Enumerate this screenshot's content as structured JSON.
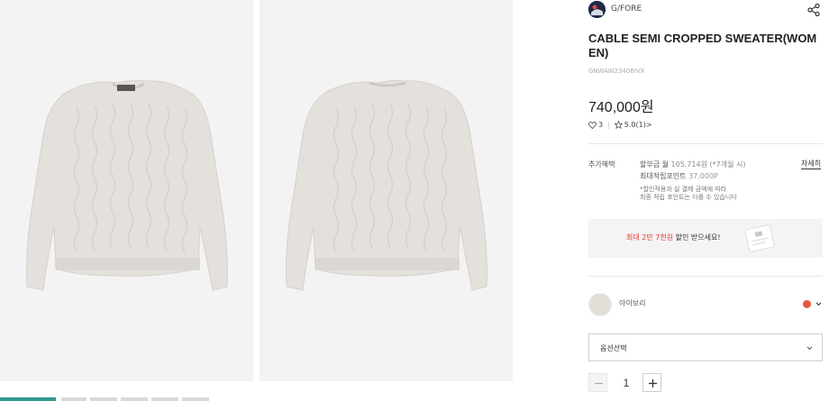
{
  "gallery": {
    "images": [
      {
        "icon": "sweater-front-image"
      },
      {
        "icon": "sweater-back-image"
      }
    ],
    "thumbnail_count": 6,
    "active_thumbnail": 1
  },
  "product": {
    "brand": "G/FORE",
    "brand_logo_icon": "brand-logo-icon",
    "name": "CABLE SEMI CROPPED SWEATER(WOMEN)",
    "code": "GNWAW23406IVX",
    "price": "740,000원",
    "likes": "3",
    "rating": "5.0(1)>",
    "share_icon": "share-icon"
  },
  "benefits": {
    "label": "추가혜택",
    "installment_prefix": "할부금 월 ",
    "installment_detail": "105,714원 (*7개월 시)",
    "points_prefix": "최대적립포인트 ",
    "points_value": "37,000P",
    "note_line1": "*할인적용과 실 결제 금액에 따라",
    "note_line2": "최종 적립 포인트는 다를 수 있습니다",
    "detail_link": "자세히"
  },
  "banner": {
    "highlight": "최대 2만 7천원",
    "text": " 할인 받으세요!"
  },
  "color_option": {
    "name": "아이보리",
    "swatch": "#e3ded8",
    "indicator_color": "#e8573d"
  },
  "option_select": {
    "label": "옵션선택"
  },
  "quantity": {
    "value": "1"
  },
  "colors": {
    "accent_red": "#e03a2e",
    "active_thumb": "#2f9a8a"
  }
}
